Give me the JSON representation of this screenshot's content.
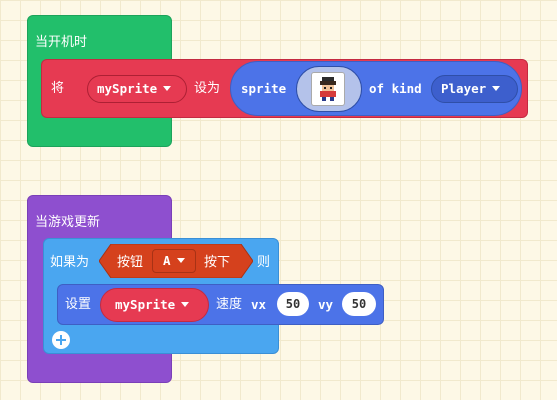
{
  "on_start": {
    "hat_label": "当开机时",
    "set_label": "将",
    "variable": "mySprite",
    "to_label": "设为",
    "sprite_label": "sprite",
    "of_kind_label": "of kind",
    "kind": "Player"
  },
  "on_update": {
    "hat_label": "当游戏更新",
    "if_label": "如果为",
    "button_label": "按钮",
    "button_value": "A",
    "pressed_label": "按下",
    "then_label": "则",
    "set_label": "设置",
    "variable": "mySprite",
    "velocity_label": "速度",
    "vx_label": "vx",
    "vx_value": "50",
    "vy_label": "vy",
    "vy_value": "50"
  },
  "colors": {
    "loops_green": "#22bf6b",
    "game_purple": "#8e4fcf",
    "logic_blue": "#4aa6f0",
    "sprites_blue": "#4c73e8",
    "variables_red": "#e63a52",
    "controller_orange": "#d5411d"
  },
  "icons": [
    "dropdown-caret-icon",
    "sprite-image-icon",
    "add-else-icon"
  ]
}
